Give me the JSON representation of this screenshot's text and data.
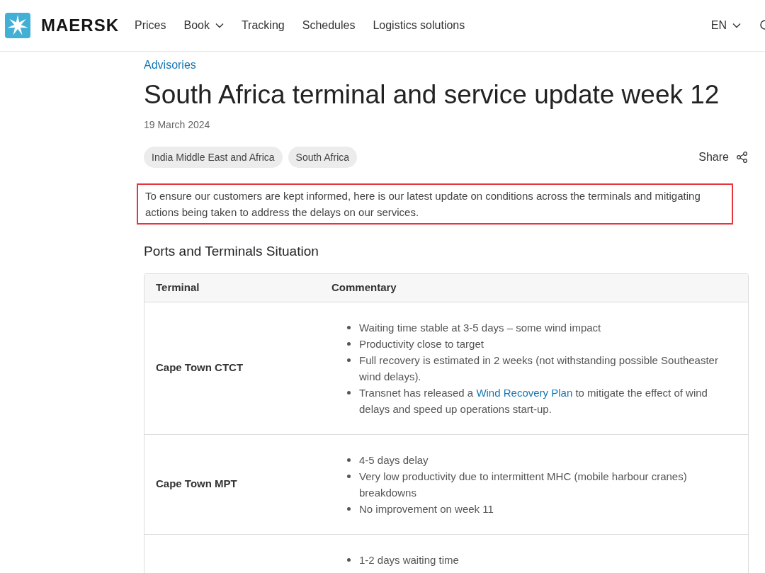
{
  "header": {
    "brand": "MAERSK",
    "nav": [
      {
        "label": "Prices",
        "dropdown": false
      },
      {
        "label": "Book",
        "dropdown": true
      },
      {
        "label": "Tracking",
        "dropdown": false
      },
      {
        "label": "Schedules",
        "dropdown": false
      },
      {
        "label": "Logistics solutions",
        "dropdown": false
      }
    ],
    "language": "EN"
  },
  "breadcrumb": "Advisories",
  "title": "South Africa terminal and service update week 12",
  "date": "19 March 2024",
  "tags": [
    "India Middle East and Africa",
    "South Africa"
  ],
  "share": "Share",
  "intro": {
    "text": "To ensure our customers are kept informed, here is our latest update on conditions across the terminals and mitigating actions being taken to address the delays on our services.",
    "highlighted": true
  },
  "section_title": "Ports and Terminals Situation",
  "table": {
    "columns": [
      "Terminal",
      "Commentary"
    ],
    "rows": [
      {
        "terminal": "Cape Town CTCT",
        "bullets": [
          [
            {
              "kind": "text",
              "text": "Waiting time stable at 3-5 days – some wind impact"
            }
          ],
          [
            {
              "kind": "text",
              "text": "Productivity close to target"
            }
          ],
          [
            {
              "kind": "text",
              "text": "Full recovery is estimated in 2 weeks (not withstanding possible Southeaster wind delays)."
            }
          ],
          [
            {
              "kind": "text",
              "text": "Transnet has released a "
            },
            {
              "kind": "link",
              "text": "Wind Recovery Plan"
            },
            {
              "kind": "text",
              "text": " to mitigate the effect of wind delays and speed up operations start-up."
            }
          ]
        ]
      },
      {
        "terminal": "Cape Town MPT",
        "bullets": [
          [
            {
              "kind": "text",
              "text": "4-5 days delay"
            }
          ],
          [
            {
              "kind": "text",
              "text": "Very low productivity due to intermittent MHC (mobile harbour cranes) breakdowns"
            }
          ],
          [
            {
              "kind": "text",
              "text": "No improvement on week 11"
            }
          ]
        ]
      },
      {
        "bullets": [
          [
            {
              "kind": "text",
              "text": "1-2 days waiting time"
            }
          ]
        ]
      }
    ]
  }
}
